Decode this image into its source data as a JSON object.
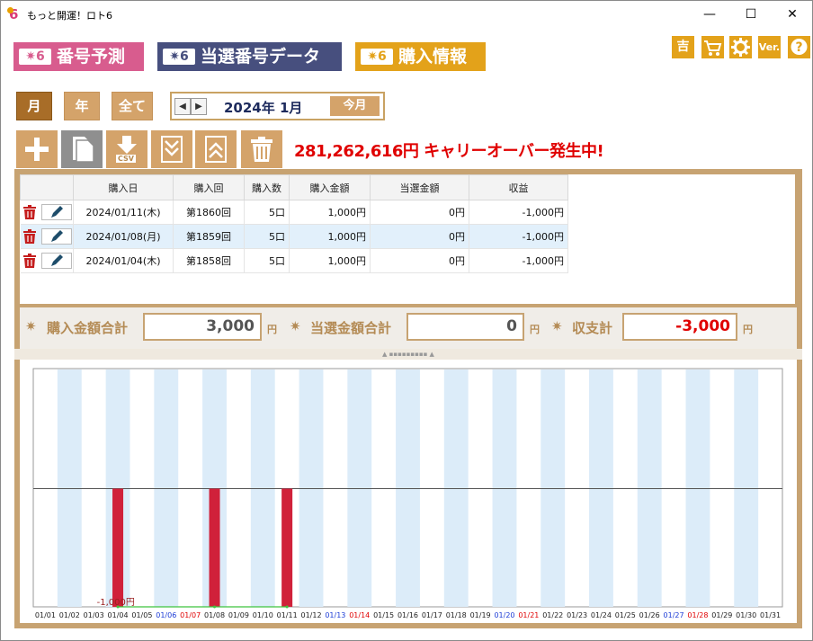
{
  "window": {
    "title": "もっと開運！ロト6",
    "minimize": "—",
    "maximize": "☐",
    "close": "✕"
  },
  "nav": [
    {
      "badge": "✷6",
      "label": "番号予測"
    },
    {
      "badge": "✷6",
      "label": "当選番号データ"
    },
    {
      "badge": "✷6",
      "label": "購入情報"
    }
  ],
  "top_icons": [
    "吉",
    "cart-icon",
    "gear-icon",
    "Ver.",
    "help-icon"
  ],
  "period": {
    "month": "月",
    "year": "年",
    "all": "全て"
  },
  "date_nav": {
    "prev": "◀",
    "next": "▶",
    "current": "2024年 1月",
    "today": "今月"
  },
  "toolbar": [
    "add-icon",
    "copy-icon",
    "csv-download-icon",
    "collapse-down-icon",
    "expand-up-icon",
    "trash-icon"
  ],
  "csv_label": "CSV",
  "carryover": "281,262,616円 キャリーオーバー発生中!",
  "table": {
    "headers": [
      "購入日",
      "購入回",
      "購入数",
      "購入金額",
      "当選金額",
      "収益"
    ],
    "rows": [
      {
        "date": "2024/01/11(木)",
        "round": "第1860回",
        "count": "5口",
        "amount": "1,000円",
        "win": "0円",
        "profit": "-1,000円"
      },
      {
        "date": "2024/01/08(月)",
        "round": "第1859回",
        "count": "5口",
        "amount": "1,000円",
        "win": "0円",
        "profit": "-1,000円"
      },
      {
        "date": "2024/01/04(木)",
        "round": "第1858回",
        "count": "5口",
        "amount": "1,000円",
        "win": "0円",
        "profit": "-1,000円"
      }
    ]
  },
  "totals": {
    "purchase_label": "購入金額合計",
    "purchase_value": "3,000",
    "win_label": "当選金額合計",
    "win_value": "0",
    "balance_label": "収支計",
    "balance_value": "-3,000",
    "yen": "円",
    "balance_color": "#e00000"
  },
  "splitter_glyph": "▲ ▪▪▪▪▪▪▪▪▪ ▲",
  "chart_data": {
    "type": "bar",
    "categories": [
      "01/01",
      "01/02",
      "01/03",
      "01/04",
      "01/05",
      "01/06",
      "01/07",
      "01/08",
      "01/09",
      "01/10",
      "01/11",
      "01/12",
      "01/13",
      "01/14",
      "01/15",
      "01/16",
      "01/17",
      "01/18",
      "01/19",
      "01/20",
      "01/21",
      "01/22",
      "01/23",
      "01/24",
      "01/25",
      "01/26",
      "01/27",
      "01/28",
      "01/29",
      "01/30",
      "01/31"
    ],
    "category_colors": {
      "01/06": "#1b3bd6",
      "01/07": "#e00000",
      "01/13": "#1b3bd6",
      "01/14": "#e00000",
      "01/20": "#1b3bd6",
      "01/21": "#e00000",
      "01/27": "#1b3bd6",
      "01/28": "#e00000"
    },
    "values": [
      0,
      0,
      0,
      -1000,
      0,
      0,
      0,
      -1000,
      0,
      0,
      -1000,
      0,
      0,
      0,
      0,
      0,
      0,
      0,
      0,
      0,
      0,
      0,
      0,
      0,
      0,
      0,
      0,
      0,
      0,
      0,
      0
    ],
    "min_label": "-1,000円",
    "ylim": [
      -1000,
      1000
    ],
    "bar_color": "#d0213a",
    "line_color": "#3ec43e",
    "stripe_color": "#dcecf9"
  }
}
